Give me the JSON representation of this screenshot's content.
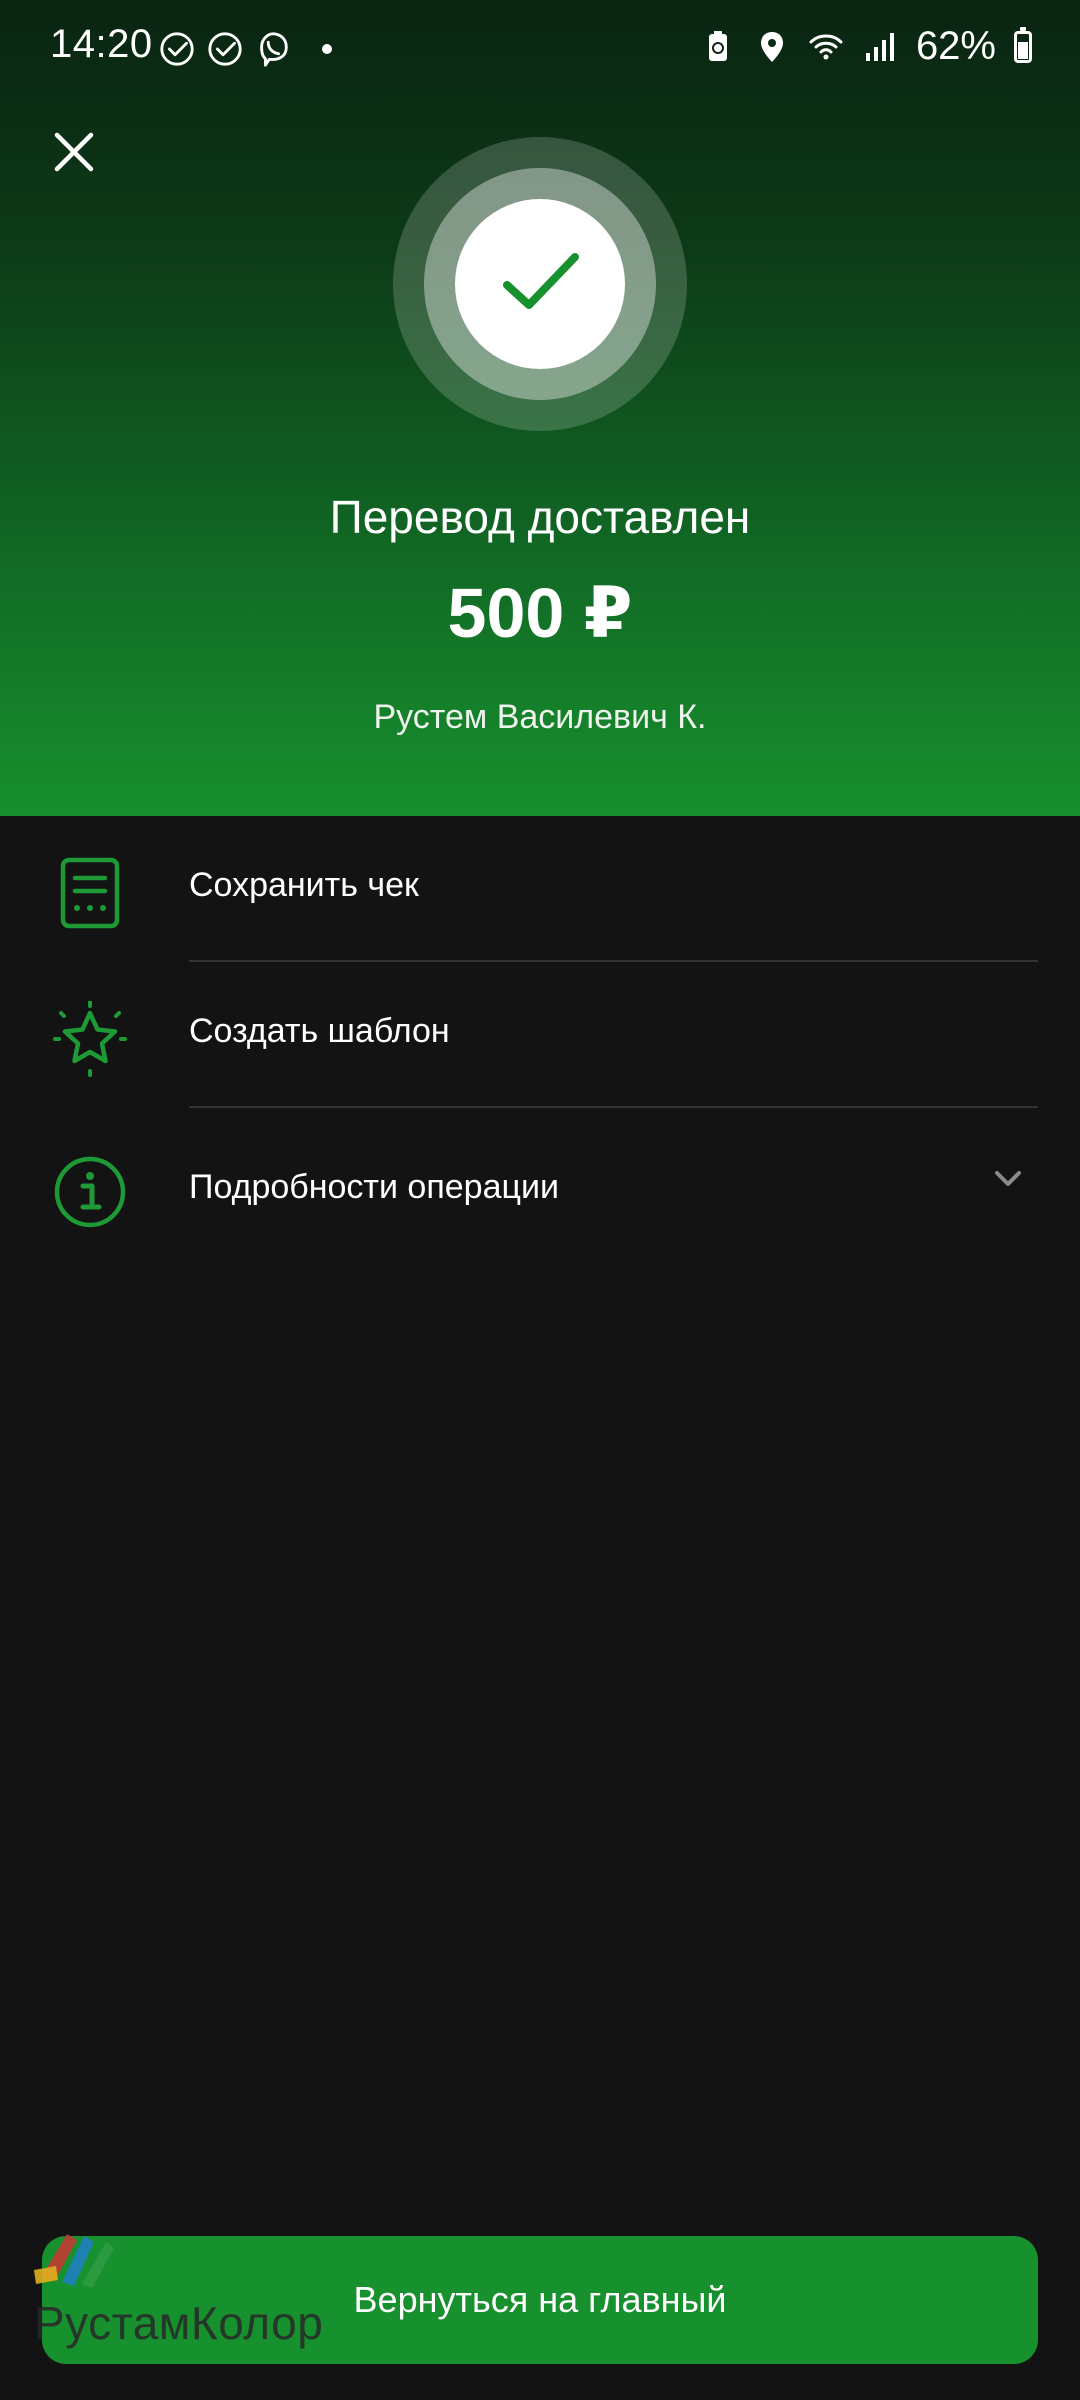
{
  "status_bar": {
    "time": "14:20",
    "battery_percent": "62%",
    "battery_level": 0.62,
    "icons_left": [
      "check-circle-icon",
      "check-circle-icon",
      "viber-icon"
    ],
    "icons_right": [
      "battery-saver-icon",
      "location-icon",
      "wifi-icon",
      "signal-icon"
    ]
  },
  "header": {
    "title": "Перевод доставлен",
    "amount": "500 ₽",
    "recipient": "Рустем Василевич К."
  },
  "actions": [
    {
      "label": "Сохранить чек",
      "icon": "receipt-icon"
    },
    {
      "label": "Создать шаблон",
      "icon": "star-icon"
    },
    {
      "label": "Подробности операции",
      "icon": "info-icon"
    }
  ],
  "footer": {
    "home_button_label": "Вернуться на главный"
  },
  "watermark": {
    "text": "РустамКолор"
  },
  "colors": {
    "accent": "#17902e",
    "background": "#131313",
    "gradient_top": "#0a2412"
  }
}
